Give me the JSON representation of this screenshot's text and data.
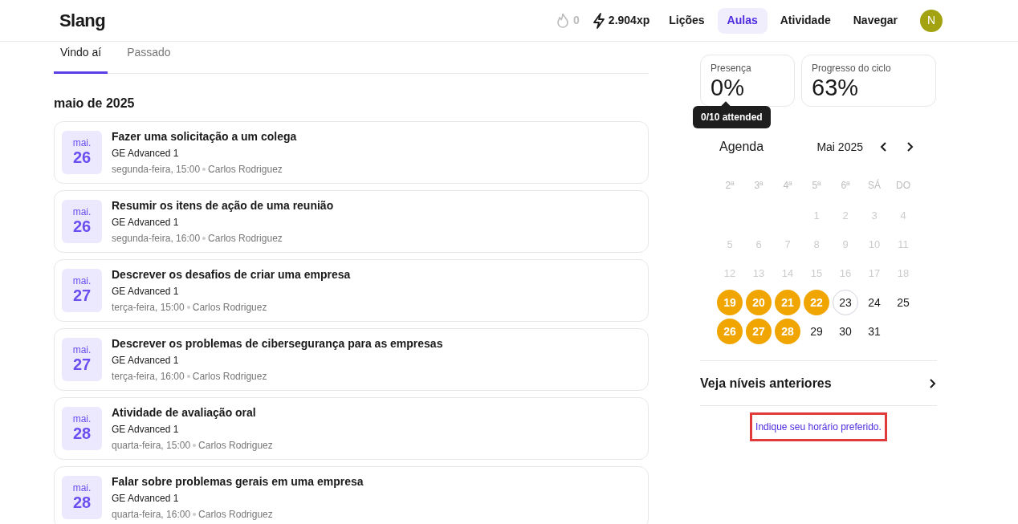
{
  "header": {
    "logo": "Slang",
    "streak": "0",
    "xp": "2.904xp",
    "nav": [
      {
        "label": "Lições",
        "selected": false
      },
      {
        "label": "Aulas",
        "selected": true
      },
      {
        "label": "Atividade",
        "selected": false
      },
      {
        "label": "Navegar",
        "selected": false
      }
    ],
    "avatar": "N"
  },
  "tabs": [
    {
      "label": "Vindo aí",
      "selected": true
    },
    {
      "label": "Passado",
      "selected": false
    }
  ],
  "month_heading": "maio de 2025",
  "lessons": [
    {
      "month": "mai.",
      "day": "26",
      "title": "Fazer uma solicitação a um colega",
      "course": "GE Advanced 1",
      "when": "segunda-feira, 15:00",
      "teacher": "Carlos Rodriguez"
    },
    {
      "month": "mai.",
      "day": "26",
      "title": "Resumir os itens de ação de uma reunião",
      "course": "GE Advanced 1",
      "when": "segunda-feira, 16:00",
      "teacher": "Carlos Rodriguez"
    },
    {
      "month": "mai.",
      "day": "27",
      "title": "Descrever os desafios de criar uma empresa",
      "course": "GE Advanced 1",
      "when": "terça-feira, 15:00",
      "teacher": "Carlos Rodriguez"
    },
    {
      "month": "mai.",
      "day": "27",
      "title": "Descrever os problemas de cibersegurança para as empresas",
      "course": "GE Advanced 1",
      "when": "terça-feira, 16:00",
      "teacher": "Carlos Rodriguez"
    },
    {
      "month": "mai.",
      "day": "28",
      "title": "Atividade de avaliação oral",
      "course": "GE Advanced 1",
      "when": "quarta-feira, 15:00",
      "teacher": "Carlos Rodriguez"
    },
    {
      "month": "mai.",
      "day": "28",
      "title": "Falar sobre problemas gerais em uma empresa",
      "course": "GE Advanced 1",
      "when": "quarta-feira, 16:00",
      "teacher": "Carlos Rodriguez"
    }
  ],
  "stats": [
    {
      "label": "Presença",
      "value": "0%",
      "tooltip": "0/10 attended"
    },
    {
      "label": "Progresso do ciclo",
      "value": "63%"
    }
  ],
  "agenda": {
    "title": "Agenda",
    "month": "Mai 2025",
    "weekdays": [
      "2ª",
      "3ª",
      "4ª",
      "5ª",
      "6ª",
      "SÁ",
      "DO"
    ],
    "weeks": [
      [
        {
          "day": "1",
          "kind": "past"
        },
        {
          "day": "2",
          "kind": "past"
        },
        {
          "day": "3",
          "kind": "past"
        },
        {
          "day": "4",
          "kind": "past"
        }
      ],
      [
        {
          "day": "5",
          "kind": "past"
        },
        {
          "day": "6",
          "kind": "past"
        },
        {
          "day": "7",
          "kind": "past"
        },
        {
          "day": "8",
          "kind": "past"
        },
        {
          "day": "9",
          "kind": "past"
        },
        {
          "day": "10",
          "kind": "past"
        },
        {
          "day": "11",
          "kind": "past"
        }
      ],
      [
        {
          "day": "12",
          "kind": "past"
        },
        {
          "day": "13",
          "kind": "past"
        },
        {
          "day": "14",
          "kind": "past"
        },
        {
          "day": "15",
          "kind": "past"
        },
        {
          "day": "16",
          "kind": "past"
        },
        {
          "day": "17",
          "kind": "past"
        },
        {
          "day": "18",
          "kind": "past"
        }
      ],
      [
        {
          "day": "19",
          "kind": "class"
        },
        {
          "day": "20",
          "kind": "class"
        },
        {
          "day": "21",
          "kind": "class"
        },
        {
          "day": "22",
          "kind": "class"
        },
        {
          "day": "23",
          "kind": "today"
        },
        {
          "day": "24",
          "kind": "normal"
        },
        {
          "day": "25",
          "kind": "normal"
        }
      ],
      [
        {
          "day": "26",
          "kind": "class"
        },
        {
          "day": "27",
          "kind": "class"
        },
        {
          "day": "28",
          "kind": "class"
        },
        {
          "day": "29",
          "kind": "normal"
        },
        {
          "day": "30",
          "kind": "normal"
        },
        {
          "day": "31",
          "kind": "normal"
        }
      ]
    ]
  },
  "previous_levels": "Veja níveis anteriores",
  "preferred_time_link": {
    "label": "Indique seu horário preferido.",
    "highlighted": true
  }
}
